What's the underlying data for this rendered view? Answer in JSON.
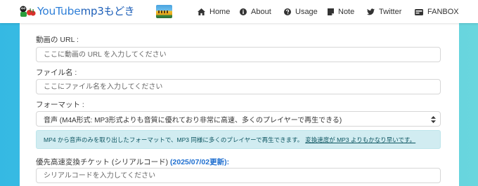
{
  "brand": {
    "title_part1": "YouTube",
    "title_part2": "mp3もどき"
  },
  "nav": {
    "items": [
      {
        "label": "Home",
        "icon": "home-icon"
      },
      {
        "label": "About",
        "icon": "info-circle-icon"
      },
      {
        "label": "Usage",
        "icon": "question-circle-icon"
      },
      {
        "label": "Note",
        "icon": "note-icon"
      },
      {
        "label": "Twitter",
        "icon": "twitter-icon"
      },
      {
        "label": "FANBOX",
        "icon": "fanbox-icon"
      }
    ]
  },
  "form": {
    "url": {
      "label": "動画の URL :",
      "placeholder": "ここに動画の URL を入力してください",
      "value": ""
    },
    "filename": {
      "label": "ファイル名 :",
      "placeholder": "ここにファイル名を入力してください",
      "value": ""
    },
    "format": {
      "label": "フォーマット :",
      "selected": "音声 (M4A形式: MP3形式よりも音質に優れており非常に高速、多くのプレイヤーで再生できる)"
    },
    "info": {
      "text": "MP4 から音声のみを取り出したフォーマットで、MP3 同様に多くのプレイヤーで再生できます。",
      "underlined": "変換速度が MP3 よりもかなり早いです。"
    },
    "ticket": {
      "label": "優先高速変換チケット (シリアルコード)",
      "updated": "(2025/07/02更新):",
      "placeholder": "シリアルコードを入力してください",
      "value": ""
    }
  },
  "colors": {
    "background_left": "#35b9e3",
    "background_right": "#6ad6de",
    "brand_blue": "#2f7fd8",
    "info_bg": "#d1ecf1",
    "info_text": "#0c5460",
    "update_blue": "#1f6fd0"
  }
}
